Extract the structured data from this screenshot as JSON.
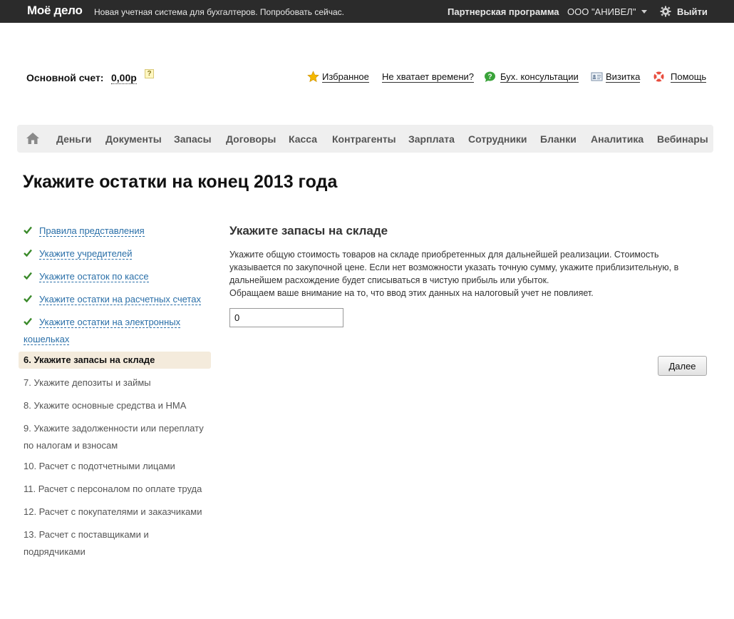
{
  "topbar": {
    "logo": "Моё дело",
    "promo": "Новая учетная система для бухгалтеров. Попробовать сейчас.",
    "partner_program": "Партнерская программа",
    "organization": "ООО \"АНИВЕЛ\"",
    "logout": "Выйти"
  },
  "account": {
    "label": "Основной счет:",
    "value": "0,00р",
    "help": "?"
  },
  "top_links": {
    "favorites": "Избранное",
    "no_time": "Не хватает времени?",
    "consult": "Бух. консультации",
    "card": "Визитка",
    "help": "Помощь"
  },
  "nav": {
    "items": [
      "Деньги",
      "Документы",
      "Запасы",
      "Договоры",
      "Касса",
      "Контрагенты",
      "Зарплата",
      "Сотрудники",
      "Бланки",
      "Аналитика",
      "Вебинары"
    ]
  },
  "page_title": "Укажите остатки на конец 2013 года",
  "steps": {
    "done": [
      "Правила представления",
      "Укажите учредителей",
      "Укажите остаток по кассе",
      "Укажите остатки на расчетных счетах",
      "Укажите остатки на электронных"
    ],
    "done_wrap": "кошельках",
    "active": "6.   Укажите запасы на складе",
    "pending": [
      "7.    Укажите депозиты и займы",
      "8.    Укажите основные средства и НМА",
      "9.    Укажите задолженности или переплату",
      "10.  Расчет с подотчетными лицами",
      "11.  Расчет с персоналом по оплате труда",
      "12.  Расчет с покупателями и заказчиками",
      "13.  Расчет с поставщиками и подрядчиками"
    ],
    "pending_wrap": "по налогам и взносам"
  },
  "main": {
    "section_title": "Укажите запасы на складе",
    "desc_line1": "Укажите общую стоимость товаров на складе приобретенных для дальнейшей реализации. Стоимость",
    "desc_line2": "указывается по закупочной цене. Если нет возможности указать точную сумму, укажите приблизительную, в",
    "desc_line3": "дальнейшем расхождение будет списываться в чистую прибыль или убыток.",
    "desc_line4": "Обращаем ваше внимание на то, что ввод этих данных на налоговый учет не повлияет.",
    "amount_value": "0",
    "next_label": "Далее"
  },
  "colors": {
    "topbar": "#2b2b2b",
    "link": "#2a6fa8",
    "check": "#3a8a2a",
    "active_step": "#f4ebdc"
  }
}
